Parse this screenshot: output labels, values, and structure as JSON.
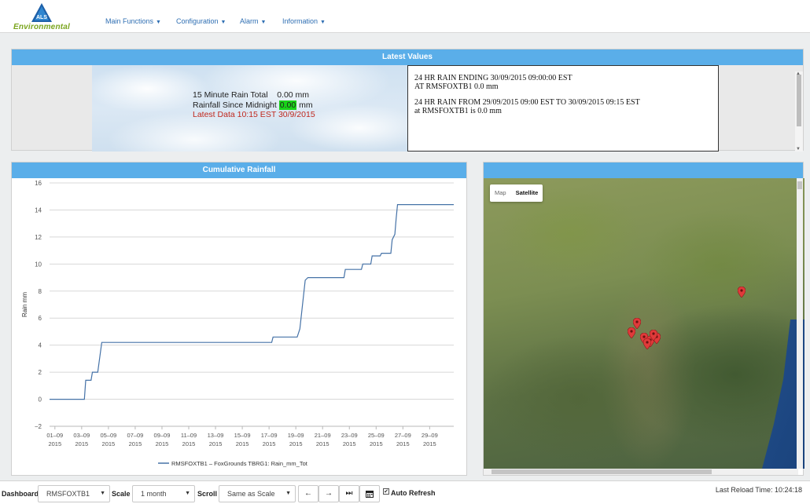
{
  "header": {
    "logo_badge": "ALS",
    "logo_text": "Environmental",
    "nav": [
      {
        "label": "Main Functions"
      },
      {
        "label": "Configuration"
      },
      {
        "label": "Alarm"
      },
      {
        "label": "Information"
      }
    ]
  },
  "latest_values": {
    "title": "Latest Values",
    "rain15_label": "15 Minute Rain Total",
    "rain15_value": "0.00 mm",
    "midnight_label": "Rainfall Since Midnight",
    "midnight_value": "0.00",
    "midnight_unit": "mm",
    "latest_data": "Latest Data 10:15 EST 30/9/2015",
    "text_lines": [
      "24 HR RAIN ENDING 30/09/2015 09:00:00 EST",
      "AT RMSFOXTB1 0.0 mm",
      "24 HR RAIN FROM 29/09/2015 09:00 EST TO 30/09/2015 09:15 EST",
      "at RMSFOXTB1 is 0.0 mm"
    ]
  },
  "chart_panel": {
    "title": "Cumulative Rainfall"
  },
  "chart_data": {
    "type": "line",
    "ylabel": "Rain mm",
    "ylim": [
      -2,
      16
    ],
    "yticks": [
      -2,
      0,
      2,
      4,
      6,
      8,
      10,
      12,
      14,
      16
    ],
    "xticks": [
      {
        "day": 1,
        "label1": "01–09",
        "label2": "2015"
      },
      {
        "day": 3,
        "label1": "03–09",
        "label2": "2015"
      },
      {
        "day": 5,
        "label1": "05–09",
        "label2": "2015"
      },
      {
        "day": 7,
        "label1": "07–09",
        "label2": "2015"
      },
      {
        "day": 9,
        "label1": "09–09",
        "label2": "2015"
      },
      {
        "day": 11,
        "label1": "11–09",
        "label2": "2015"
      },
      {
        "day": 13,
        "label1": "13–09",
        "label2": "2015"
      },
      {
        "day": 15,
        "label1": "15–09",
        "label2": "2015"
      },
      {
        "day": 17,
        "label1": "17–09",
        "label2": "2015"
      },
      {
        "day": 19,
        "label1": "19–09",
        "label2": "2015"
      },
      {
        "day": 21,
        "label1": "21–09",
        "label2": "2015"
      },
      {
        "day": 23,
        "label1": "23–09",
        "label2": "2015"
      },
      {
        "day": 25,
        "label1": "25–09",
        "label2": "2015"
      },
      {
        "day": 27,
        "label1": "27–09",
        "label2": "2015"
      },
      {
        "day": 29,
        "label1": "29–09",
        "label2": "2015"
      }
    ],
    "xlim_day": [
      0.6,
      30.8
    ],
    "grid": true,
    "legend_position": "bottom-center",
    "series": [
      {
        "name": "RMSFOXTB1 – FoxGrounds TBRG1: Rain_mm_Tot",
        "color": "#4572a7",
        "points": [
          [
            0.6,
            0
          ],
          [
            3.2,
            0
          ],
          [
            3.3,
            1.4
          ],
          [
            3.7,
            1.4
          ],
          [
            3.8,
            2.0
          ],
          [
            4.2,
            2.0
          ],
          [
            4.5,
            4.2
          ],
          [
            17.2,
            4.2
          ],
          [
            17.3,
            4.6
          ],
          [
            19.1,
            4.6
          ],
          [
            19.3,
            5.2
          ],
          [
            19.7,
            8.8
          ],
          [
            19.9,
            9.0
          ],
          [
            22.6,
            9.0
          ],
          [
            22.7,
            9.6
          ],
          [
            23.9,
            9.6
          ],
          [
            24.0,
            10.0
          ],
          [
            24.6,
            10.0
          ],
          [
            24.7,
            10.6
          ],
          [
            25.3,
            10.6
          ],
          [
            25.4,
            10.8
          ],
          [
            26.1,
            10.8
          ],
          [
            26.2,
            11.8
          ],
          [
            26.4,
            12.2
          ],
          [
            26.5,
            13.4
          ],
          [
            26.6,
            14.4
          ],
          [
            30.8,
            14.4
          ]
        ]
      }
    ]
  },
  "map": {
    "map_btn": "Map",
    "satellite_btn": "Satellite",
    "marker_color": "#e03a3a",
    "markers": [
      {
        "x": 0.805,
        "y": 0.41
      },
      {
        "x": 0.478,
        "y": 0.52
      },
      {
        "x": 0.46,
        "y": 0.55
      },
      {
        "x": 0.5,
        "y": 0.57
      },
      {
        "x": 0.52,
        "y": 0.58
      },
      {
        "x": 0.54,
        "y": 0.57
      },
      {
        "x": 0.51,
        "y": 0.59
      },
      {
        "x": 0.53,
        "y": 0.56
      }
    ]
  },
  "bottom": {
    "dashboard_label": "Dashboard",
    "dashboard_value": "RMSFOXTB1",
    "scale_label": "Scale",
    "scale_value": "1 month",
    "scroll_label": "Scroll",
    "scroll_value": "Same as Scale",
    "auto_refresh_label": "Auto Refresh",
    "auto_refresh_checked": "✔",
    "reload_time": "Last Reload Time:  10:24:18"
  }
}
